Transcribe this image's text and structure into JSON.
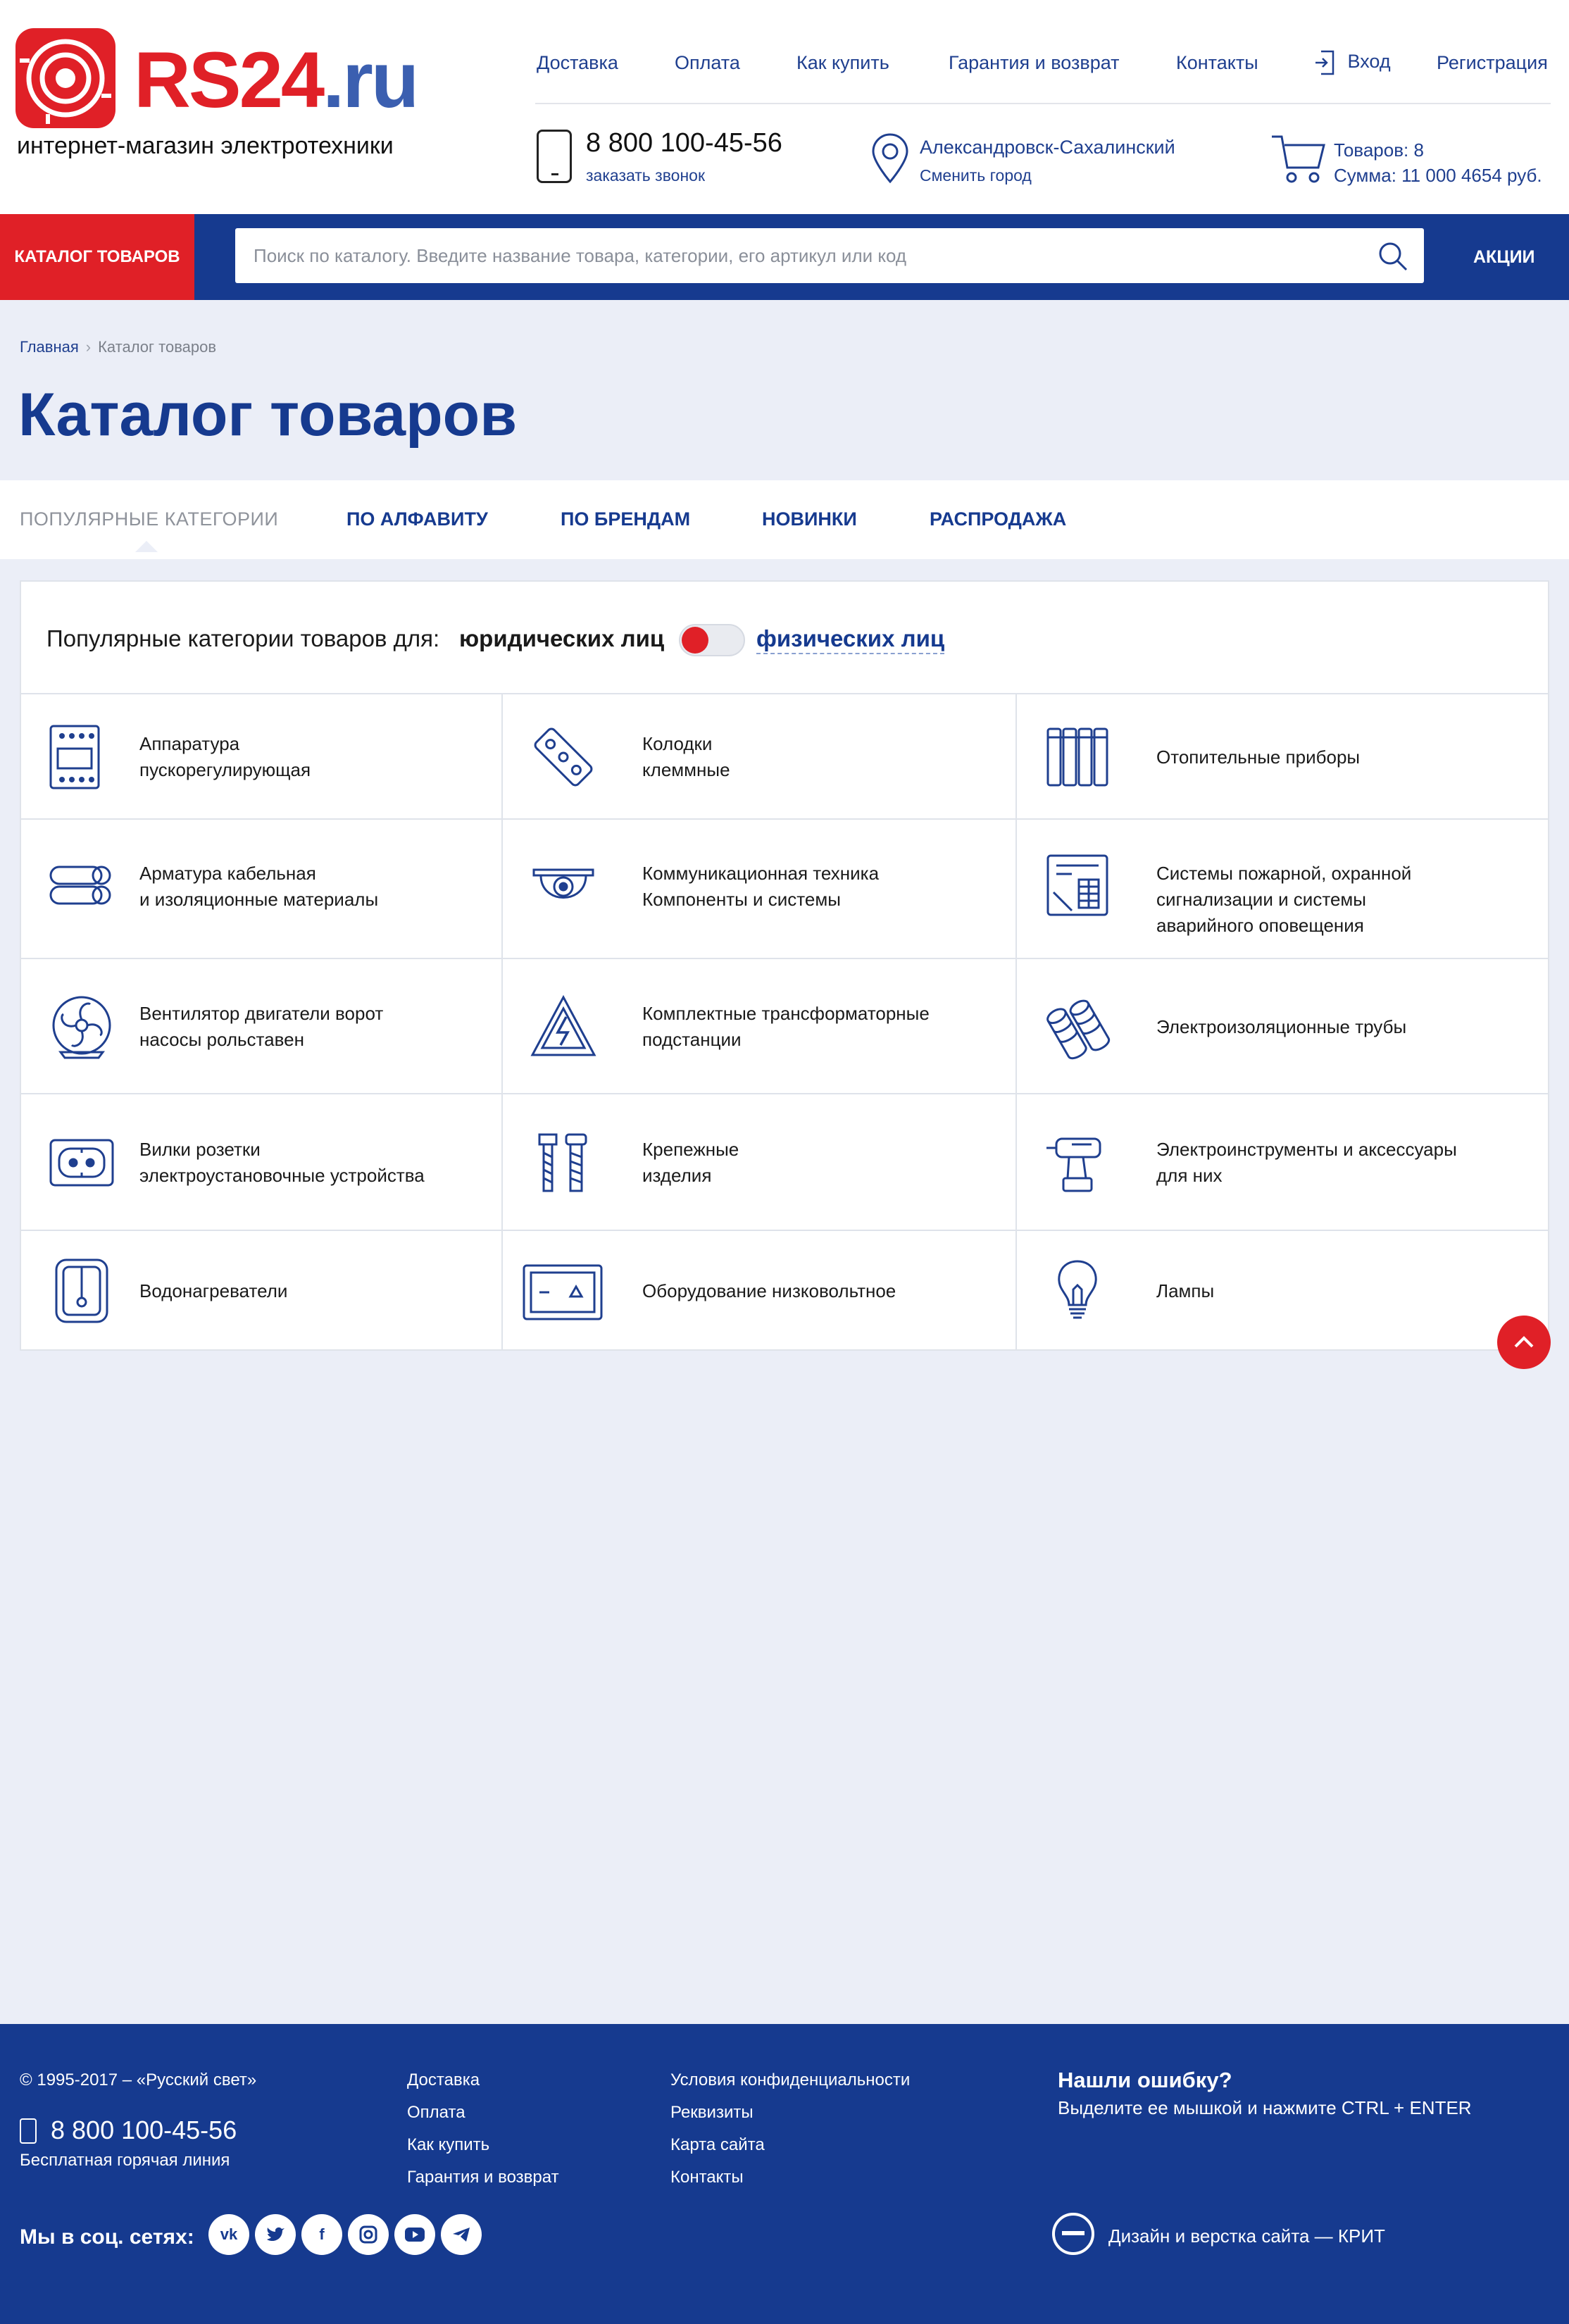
{
  "header": {
    "logo_text": "RS24",
    "logo_domain": ".ru",
    "tagline": "интернет-магазин электротехники",
    "nav": [
      "Доставка",
      "Оплата",
      "Как купить",
      "Гарантия и возврат",
      "Контакты"
    ],
    "login": "Вход",
    "register": "Регистрация",
    "phone": "8 800 100-45-56",
    "callback": "заказать звонок",
    "city": "Александровск-Сахалинский",
    "change_city": "Сменить город",
    "cart_items": "Товаров: 8",
    "cart_sum": "Сумма: 11 000 4654 руб."
  },
  "navbar": {
    "catalog": "КАТАЛОГ ТОВАРОВ",
    "search_placeholder": "Поиск по каталогу. Введите название товара, категории, его артикул или код",
    "promo": "АКЦИИ"
  },
  "breadcrumb": {
    "home": "Главная",
    "current": "Каталог товаров"
  },
  "page_title": "Каталог товаров",
  "tabs": [
    "ПОПУЛЯРНЫЕ КАТЕГОРИИ",
    "ПО АЛФАВИТУ",
    "ПО БРЕНДАМ",
    "НОВИНКИ",
    "РАСПРОДАЖА"
  ],
  "panel": {
    "label": "Популярные категории товаров для:",
    "legal": "юридических лиц",
    "physical": "физических лиц",
    "toggle_on": true
  },
  "categories": [
    {
      "icon": "control-panel-icon",
      "lines": [
        "Аппаратура",
        "пускорегулирующая"
      ]
    },
    {
      "icon": "terminal-block-icon",
      "lines": [
        "Колодки",
        "клеммные"
      ]
    },
    {
      "icon": "radiator-icon",
      "lines": [
        "Отопительные приборы"
      ]
    },
    {
      "icon": "cable-rolls-icon",
      "lines": [
        "Арматура кабельная",
        "и изоляционные материалы"
      ]
    },
    {
      "icon": "camera-icon",
      "lines": [
        "Коммуникационная техника",
        "Компоненты и системы"
      ]
    },
    {
      "icon": "alarm-panel-icon",
      "lines": [
        "Системы пожарной, охранной",
        "сигнализации и системы",
        "аварийного оповещения"
      ]
    },
    {
      "icon": "fan-icon",
      "lines": [
        "Вентилятор двигатели ворот",
        "насосы рольставен"
      ]
    },
    {
      "icon": "high-voltage-icon",
      "lines": [
        "Комплектные трансформаторные",
        "подстанции"
      ]
    },
    {
      "icon": "pipes-icon",
      "lines": [
        "Электроизоляционные трубы"
      ]
    },
    {
      "icon": "socket-icon",
      "lines": [
        "Вилки розетки",
        "электроустановочные устройства"
      ]
    },
    {
      "icon": "bolts-icon",
      "lines": [
        "Крепежные",
        "изделия"
      ]
    },
    {
      "icon": "drill-icon",
      "lines": [
        "Электроинструменты и аксессуары",
        "для них"
      ]
    },
    {
      "icon": "water-heater-icon",
      "lines": [
        "Водонагреватели"
      ]
    },
    {
      "icon": "low-voltage-box-icon",
      "lines": [
        "Оборудование низковольтное"
      ]
    },
    {
      "icon": "lamp-icon",
      "lines": [
        "Лампы"
      ]
    }
  ],
  "footer": {
    "copyright": "© 1995-2017 – «Русский свет»",
    "phone": "8 800 100-45-56",
    "hotline": "Бесплатная горячая линия",
    "col1": [
      "Доставка",
      "Оплата",
      "Как купить",
      "Гарантия и возврат"
    ],
    "col2": [
      "Условия конфиденциальности",
      "Реквизиты",
      "Карта сайта",
      "Контакты"
    ],
    "error_title": "Нашли ошибку?",
    "error_text": "Выделите ее мышкой и нажмите CTRL + ENTER",
    "social_label": "Мы в соц. сетях:",
    "social": [
      "vk-icon",
      "twitter-icon",
      "facebook-icon",
      "instagram-icon",
      "youtube-icon",
      "telegram-icon"
    ],
    "credit": "Дизайн и верстка сайта — КРИТ"
  },
  "colors": {
    "brand_red": "#e02027",
    "brand_blue": "#163a8f",
    "page_bg": "#ebeef7"
  }
}
